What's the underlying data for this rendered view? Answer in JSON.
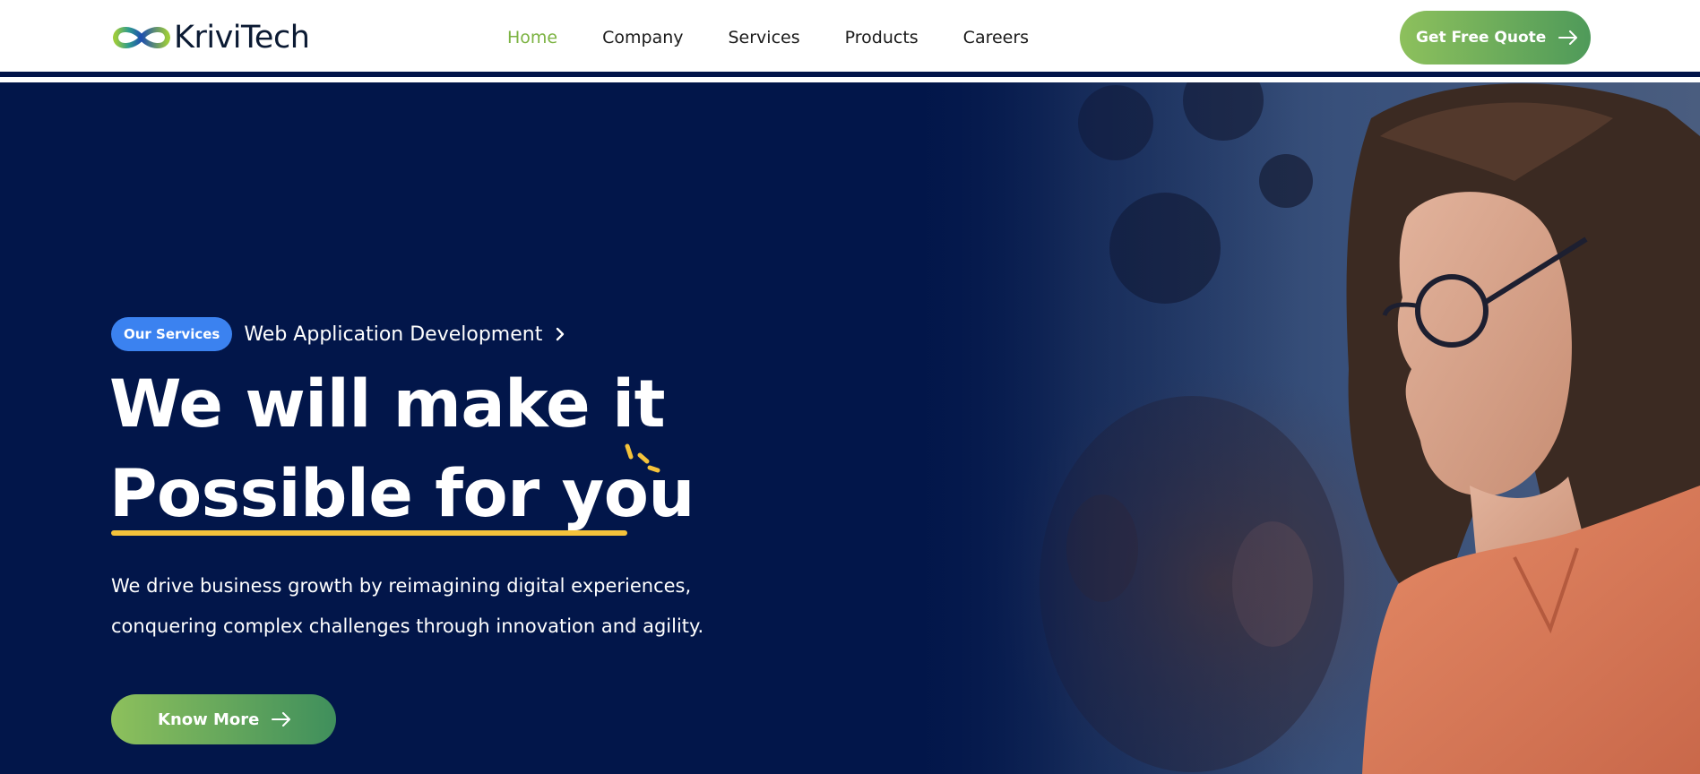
{
  "brand": {
    "name": "KriviTech",
    "logo_icon": "infinity-logo-icon"
  },
  "nav": {
    "items": [
      {
        "label": "Home",
        "active": true
      },
      {
        "label": "Company",
        "active": false
      },
      {
        "label": "Services",
        "active": false
      },
      {
        "label": "Products",
        "active": false
      },
      {
        "label": "Careers",
        "active": false
      }
    ]
  },
  "header": {
    "cta_label": "Get Free Quote",
    "cta_icon": "arrow-right-icon"
  },
  "hero": {
    "badge": "Our Services",
    "service_link": "Web Application Development",
    "service_icon": "chevron-right-icon",
    "headline_line1": "We will make it",
    "headline_line2": "Possible for you",
    "description_line1": "We drive business growth by reimagining digital experiences,",
    "description_line2": "conquering complex challenges through innovation and agility.",
    "button_label": "Know More",
    "button_icon": "arrow-right-icon"
  },
  "colors": {
    "navy": "#02164a",
    "accent_green": "#7cb342",
    "badge_blue": "#3b82f0",
    "highlight_yellow": "#f5c33b",
    "button_gradient_start": "#8dc05c",
    "button_gradient_end": "#3f8f5c"
  }
}
